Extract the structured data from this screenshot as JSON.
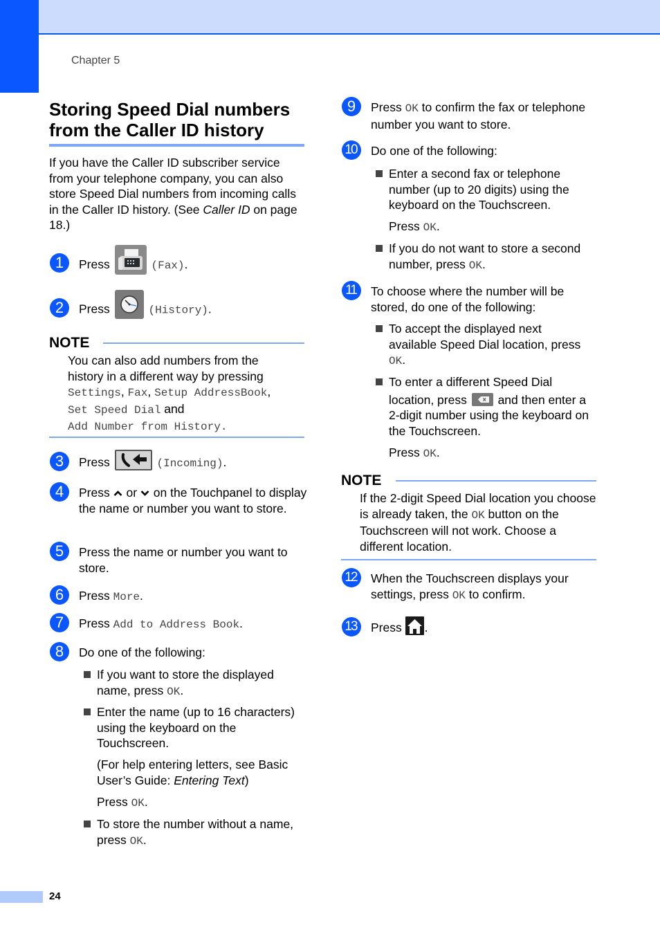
{
  "header": {
    "chapter": "Chapter 5"
  },
  "section": {
    "title_line1": "Storing Speed Dial numbers",
    "title_line2": "from the Caller ID history",
    "intro_pre": "If you have the Caller ID subscriber service from your telephone company, you can also store Speed Dial numbers from incoming calls in the Caller ID history. (See ",
    "intro_link": "Caller ID",
    "intro_post": " on page 18.)"
  },
  "steps": {
    "s1": {
      "num": "1",
      "press": "Press",
      "icon": "fax-icon",
      "code": "(Fax)",
      "post": "."
    },
    "s2": {
      "num": "2",
      "press": "Press",
      "icon": "history-clock-icon",
      "code": "(History)",
      "post": "."
    },
    "note1": {
      "head": "NOTE",
      "text1": "You can also add numbers from the",
      "text2": "history in a different way by pressing",
      "c1": "Settings",
      "sep1": ", ",
      "c2": "Fax",
      "sep2": ", ",
      "c3": "Setup AddressBook",
      "sep3": ",",
      "c4": "Set Speed Dial",
      "and": " and",
      "c5": "Add Number from History",
      "end": "."
    },
    "s3": {
      "num": "3",
      "press": "Press",
      "icon": "incoming-call-icon",
      "code": "(Incoming)",
      "post": "."
    },
    "s4": {
      "num": "4",
      "pre": "Press",
      "or": "or",
      "post": "on the Touchpanel to display the name or number you want to store.",
      "up_icon": "chevron-up-icon",
      "down_icon": "chevron-down-icon"
    },
    "s5": {
      "num": "5",
      "text": "Press the name or number you want to store."
    },
    "s6": {
      "num": "6",
      "press": "Press ",
      "code": "More",
      "post": "."
    },
    "s7": {
      "num": "7",
      "press": "Press ",
      "code": "Add to Address Book",
      "post": "."
    },
    "s8": {
      "num": "8",
      "text": "Do one of the following:",
      "b1_pre": "If you want to store the displayed name, press ",
      "b1_code": "OK",
      "b1_post": ".",
      "b2": "Enter the name (up to 16 characters) using the keyboard on the Touchscreen.",
      "b2_help_pre": "(For help entering letters, see Basic User’s Guide: ",
      "b2_help_link": "Entering Text",
      "b2_help_post": ")",
      "b2_press": "Press ",
      "b2_code": "OK",
      "b2_post": ".",
      "b3_pre": "To store the number without a name, press ",
      "b3_code": "OK",
      "b3_post": "."
    },
    "s9": {
      "num": "9",
      "pre": "Press ",
      "code": "OK",
      "post": " to confirm the fax or telephone number you want to store."
    },
    "s10": {
      "num": "10",
      "text": "Do one of the following:",
      "b1": "Enter a second fax or telephone number (up to 20 digits) using the keyboard on the Touchscreen.",
      "b1_press": "Press ",
      "b1_code": "OK",
      "b1_post": ".",
      "b2_pre": "If you do not want to store a second number, press ",
      "b2_code": "OK",
      "b2_post": "."
    },
    "s11": {
      "num": "11",
      "text": "To choose where the number will be stored, do one of the following:",
      "b1_pre": "To accept the displayed next available Speed Dial location, press ",
      "b1_code": "OK",
      "b1_post": ".",
      "b2_line1": "To enter a different Speed Dial",
      "b2_pre": "location, press ",
      "b2_mid": " and then enter a 2-digit number using the keyboard on the Touchscreen.",
      "b2_icon": "backspace-icon",
      "b2_press": "Press ",
      "b2_code": "OK",
      "b2_post": "."
    },
    "note2": {
      "head": "NOTE",
      "pre": "If the 2-digit Speed Dial location you choose is already taken, the ",
      "code": "OK",
      "post": " button on the Touchscreen will not work. Choose a different location."
    },
    "s12": {
      "num": "12",
      "pre": "When the Touchscreen displays your settings, press ",
      "code": "OK",
      "post": " to confirm."
    },
    "s13": {
      "num": "13",
      "press": "Press ",
      "icon": "home-icon",
      "post": "."
    }
  },
  "footer": {
    "page": "24"
  },
  "colors": {
    "accent": "#0a56ff",
    "band": "#ccdcfc",
    "rule": "#7da6f5",
    "footer_tab": "#b0cafa"
  }
}
